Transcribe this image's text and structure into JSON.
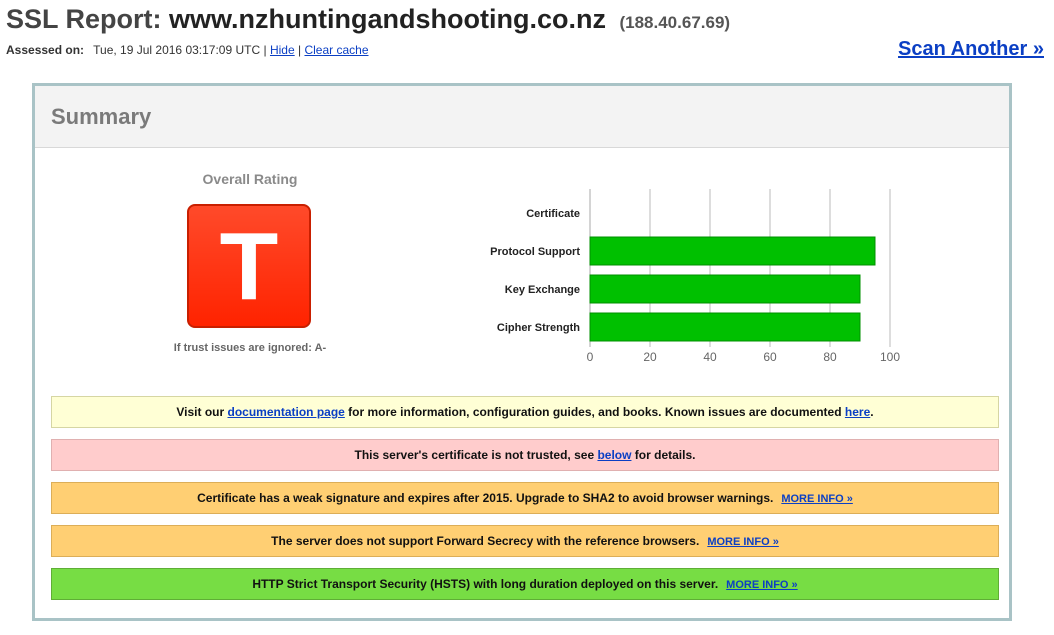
{
  "header": {
    "title_prefix": "SSL Report:",
    "hostname": "www.nzhuntingandshooting.co.nz",
    "ip": "(188.40.67.69)",
    "assessed_label": "Assessed on:",
    "assessed_date": "Tue, 19 Jul 2016 03:17:09 UTC",
    "separator": "|",
    "hide_link": "Hide",
    "clear_cache_link": "Clear cache",
    "scan_another": "Scan Another »"
  },
  "summary": {
    "title": "Summary",
    "overall_label": "Overall Rating",
    "grade": "T",
    "trust_note": "If trust issues are ignored: A-",
    "grade_color": "#ff2300"
  },
  "chart_data": {
    "type": "bar",
    "orientation": "horizontal",
    "categories": [
      "Certificate",
      "Protocol Support",
      "Key Exchange",
      "Cipher Strength"
    ],
    "values": [
      0,
      95,
      90,
      90
    ],
    "xlim": [
      0,
      100
    ],
    "ticks": [
      0,
      20,
      40,
      60,
      80,
      100
    ],
    "grid": true,
    "bar_color": "#00c000"
  },
  "messages": [
    {
      "type": "yellow",
      "pre": "Visit our ",
      "link1": "documentation page",
      "mid": " for more information, configuration guides, and books. Known issues are documented ",
      "link2": "here",
      "post": "."
    },
    {
      "type": "red",
      "pre": "This server's certificate is not trusted, see ",
      "link1": "below",
      "post": " for details."
    },
    {
      "type": "orange",
      "text": "Certificate has a weak signature and expires after 2015. Upgrade to SHA2 to avoid browser warnings.",
      "more": "MORE INFO »"
    },
    {
      "type": "orange",
      "text": "The server does not support Forward Secrecy with the reference browsers.",
      "more": "MORE INFO »"
    },
    {
      "type": "green",
      "text": "HTTP Strict Transport Security (HSTS) with long duration deployed on this server.",
      "more": "MORE INFO »"
    }
  ]
}
